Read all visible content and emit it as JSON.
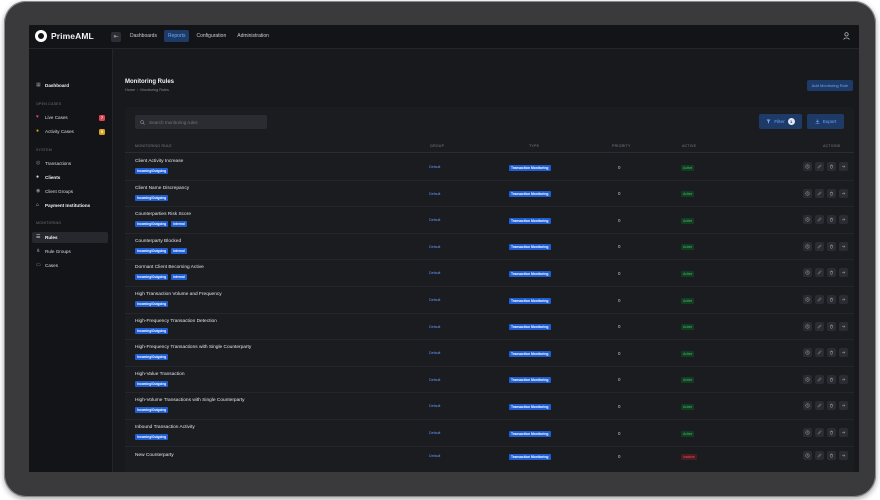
{
  "brand": {
    "name": "PrimeAML"
  },
  "topnav": [
    {
      "label": "Dashboards",
      "active": false
    },
    {
      "label": "Reports",
      "active": true
    },
    {
      "label": "Configuration",
      "active": false
    },
    {
      "label": "Administration",
      "active": false
    }
  ],
  "sidebar": {
    "dashboard": "Dashboard",
    "sections": {
      "open_cases": "OPEN CASES",
      "system": "SYSTEM",
      "monitoring": "MONITORING"
    },
    "live_cases": {
      "label": "Live Cases",
      "count": "7"
    },
    "activity_cases": {
      "label": "Activity Cases",
      "count": "5"
    },
    "system_items": [
      "Transactions",
      "Clients",
      "Client Groups",
      "Payment Institutions"
    ],
    "monitoring_items": [
      "Rules",
      "Rule Groups",
      "Cases"
    ]
  },
  "page": {
    "title": "Monitoring Rules",
    "breadcrumb": [
      "Home",
      "›",
      "Monitoring Rules"
    ],
    "add_button": "Add Monitoring Rule"
  },
  "toolbar": {
    "search_placeholder": "Search monitoring rules",
    "filter_label": "Filter",
    "filter_count": "1",
    "export_label": "Export"
  },
  "table": {
    "headers": {
      "rule": "MONITORING RULE",
      "group": "GROUP",
      "type": "TYPE",
      "priority": "PRIORITY",
      "active": "ACTIVE",
      "actions": "ACTIONS"
    },
    "rows": [
      {
        "name": "Client Activity Increase",
        "tags": [
          "Incoming/Outgoing"
        ],
        "group": "Default",
        "type": "Transaction Monitoring",
        "priority": "0",
        "status": "Active"
      },
      {
        "name": "Client Name Discrepancy",
        "tags": [
          "Incoming/Outgoing"
        ],
        "group": "Default",
        "type": "Transaction Monitoring",
        "priority": "0",
        "status": "Active"
      },
      {
        "name": "Counterparties Risk Score",
        "tags": [
          "Incoming/Outgoing",
          "Internal"
        ],
        "group": "Default",
        "type": "Transaction Monitoring",
        "priority": "0",
        "status": "Active"
      },
      {
        "name": "Counterparty Blocked",
        "tags": [
          "Incoming/Outgoing",
          "Internal"
        ],
        "group": "Default",
        "type": "Transaction Monitoring",
        "priority": "0",
        "status": "Active"
      },
      {
        "name": "Dormant Client Becoming Active",
        "tags": [
          "Incoming/Outgoing",
          "Internal"
        ],
        "group": "Default",
        "type": "Transaction Monitoring",
        "priority": "0",
        "status": "Active"
      },
      {
        "name": "High Transaction Volume and Frequency",
        "tags": [
          "Incoming/Outgoing"
        ],
        "group": "Default",
        "type": "Transaction Monitoring",
        "priority": "0",
        "status": "Active"
      },
      {
        "name": "High-Frequency Transaction Detection",
        "tags": [
          "Incoming/Outgoing"
        ],
        "group": "Default",
        "type": "Transaction Monitoring",
        "priority": "0",
        "status": "Active"
      },
      {
        "name": "High-Frequency Transactions with Single Counterparty",
        "tags": [
          "Incoming/Outgoing"
        ],
        "group": "Default",
        "type": "Transaction Monitoring",
        "priority": "0",
        "status": "Active"
      },
      {
        "name": "High-Value Transaction",
        "tags": [
          "Incoming/Outgoing"
        ],
        "group": "Default",
        "type": "Transaction Monitoring",
        "priority": "0",
        "status": "Active"
      },
      {
        "name": "High-Volume Transactions with Single Counterparty",
        "tags": [
          "Incoming/Outgoing"
        ],
        "group": "Default",
        "type": "Transaction Monitoring",
        "priority": "0",
        "status": "Active"
      },
      {
        "name": "Inbound Transaction Activity",
        "tags": [
          "Incoming/Outgoing"
        ],
        "group": "Default",
        "type": "Transaction Monitoring",
        "priority": "0",
        "status": "Active"
      },
      {
        "name": "New Counterparty",
        "tags": [],
        "group": "Default",
        "type": "Transaction Monitoring",
        "priority": "0",
        "status": "Inactive"
      }
    ]
  },
  "colors": {
    "accent": "#1f5fd6",
    "active": "#3fbf6a",
    "inactive": "#e0565f",
    "badge_red": "#e0454f",
    "badge_yellow": "#d9a31c"
  }
}
